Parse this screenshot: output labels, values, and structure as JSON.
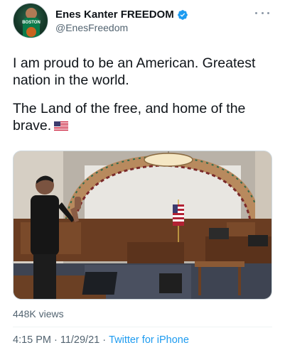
{
  "author": {
    "display_name": "Enes Kanter FREEDOM",
    "handle": "@EnesFreedom",
    "verified": true,
    "avatar_jersey_text": "BOSTON"
  },
  "tweet": {
    "paragraph_1": "I am proud to be an American. Greatest nation in the world.",
    "paragraph_2": "The Land of the free, and home of the brave.",
    "flag_emoji": "us-flag-icon"
  },
  "stats": {
    "views": "448K views"
  },
  "meta": {
    "time": "4:15 PM",
    "date": "11/29/21",
    "source": "Twitter for iPhone",
    "separator": "·"
  },
  "colors": {
    "link": "#1d9bf0",
    "secondary_text": "#536471",
    "verified_badge": "#1d9bf0"
  }
}
